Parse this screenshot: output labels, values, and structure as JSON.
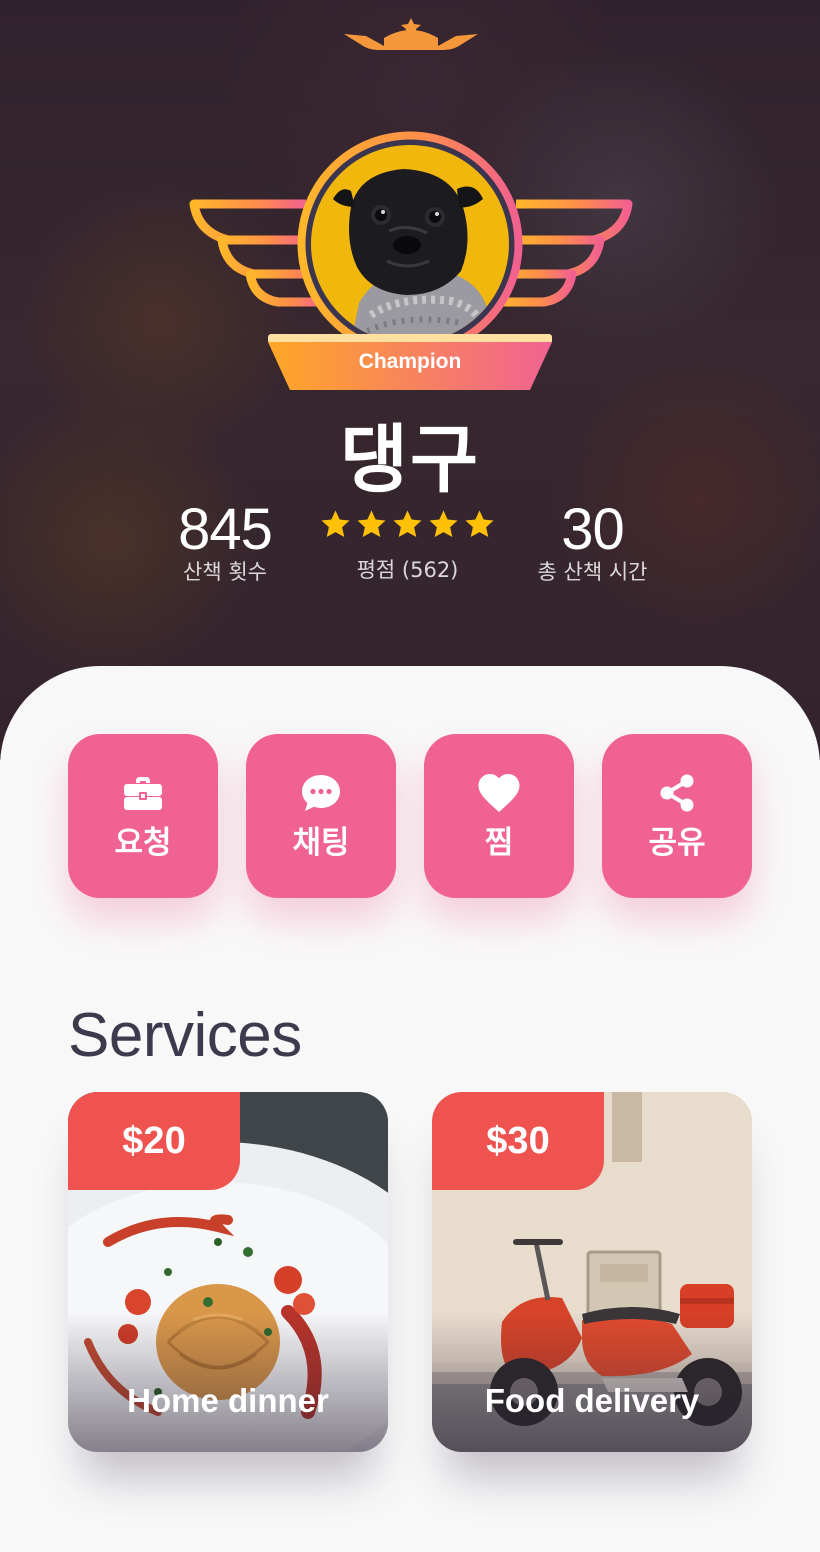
{
  "profile": {
    "rank": "Champion",
    "name": "댕구",
    "avatar": "pug-dog-photo"
  },
  "stats": {
    "walks": {
      "value": "845",
      "label": "산책 횟수"
    },
    "rating": {
      "stars": 5,
      "label": "평점 (562)"
    },
    "time": {
      "value": "30",
      "label": "총 산책 시간"
    }
  },
  "actions": [
    {
      "label": "요청",
      "icon": "briefcase-icon"
    },
    {
      "label": "채팅",
      "icon": "chat-bubble-icon"
    },
    {
      "label": "찜",
      "icon": "heart-icon"
    },
    {
      "label": "공유",
      "icon": "share-icon"
    }
  ],
  "services": {
    "title": "Services",
    "items": [
      {
        "price": "$20",
        "title": "Home dinner",
        "image": "pasta-plate-photo"
      },
      {
        "price": "$30",
        "title": "Food delivery",
        "image": "red-scooter-photo"
      }
    ]
  },
  "colors": {
    "accent_pink": "#f06292",
    "price_red": "#ef5350",
    "badge_orange": "#ffa726",
    "badge_pink": "#f06292",
    "star_gold": "#ffc107",
    "title_text": "#3e3a4e"
  }
}
